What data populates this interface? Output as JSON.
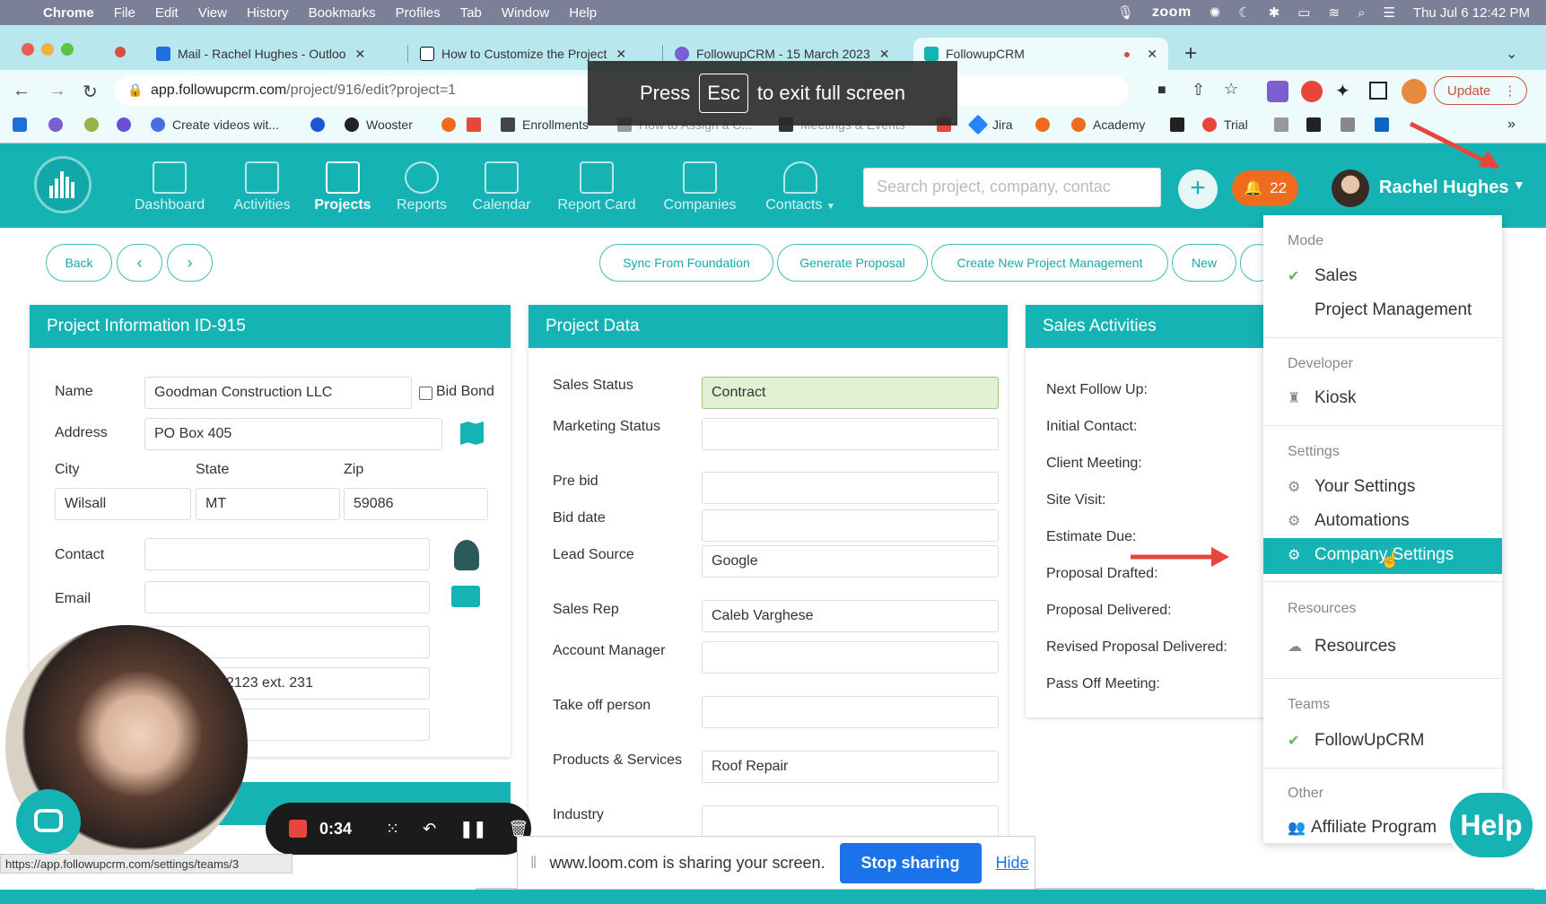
{
  "mac": {
    "menus": [
      "Chrome",
      "File",
      "Edit",
      "View",
      "History",
      "Bookmarks",
      "Profiles",
      "Tab",
      "Window",
      "Help"
    ],
    "zoom": "zoom",
    "clock": "Thu Jul 6  12:42 PM"
  },
  "browser": {
    "tabs": [
      {
        "title": "Mail - Rachel Hughes - Outloo",
        "color": "#1e6fd9"
      },
      {
        "title": "How to Customize the Project",
        "color": "#111111"
      },
      {
        "title": "FollowupCRM - 15 March 2023",
        "color": "#7b5fd1"
      },
      {
        "title": "FollowupCRM",
        "color": "#16b3b4"
      }
    ],
    "url_host": "app.followupcrm.com",
    "url_path": "/project/916/edit?project=1",
    "update_label": "Update",
    "bookmarks": [
      "Create videos wit...",
      "Wooster",
      "Enrollments",
      "How to Assign a C...",
      "Meetings & Events",
      "Jira",
      "Academy",
      "Trial"
    ],
    "fullscreen": {
      "press": "Press",
      "key": "Esc",
      "rest": "to exit full screen"
    }
  },
  "app": {
    "nav": [
      "Dashboard",
      "Activities",
      "Projects",
      "Reports",
      "Calendar",
      "Report Card",
      "Companies",
      "Contacts"
    ],
    "search_placeholder": "Search project, company, contac",
    "notif_count": "22",
    "user_name": "Rachel Hughes",
    "brand_color": "#16b3b4"
  },
  "actions": {
    "back": "Back",
    "sync": "Sync From Foundation",
    "generate": "Generate Proposal",
    "create_pm": "Create New Project Management",
    "new": "New"
  },
  "project_info": {
    "title": "Project Information ID-915",
    "name_label": "Name",
    "name_value": "Goodman Construction LLC",
    "bid_bond": "Bid Bond",
    "address_label": "Address",
    "address_value": "PO Box 405",
    "city_label": "City",
    "city_value": "Wilsall",
    "state_label": "State",
    "state_value": "MT",
    "zip_label": "Zip",
    "zip_value": "59086",
    "contact_label": "Contact",
    "email_label": "Email",
    "phone_fragment": "2123 ext. 231"
  },
  "project_data": {
    "title": "Project Data",
    "rows": [
      {
        "label": "Sales Status",
        "value": "Contract"
      },
      {
        "label": "Marketing Status",
        "value": ""
      },
      {
        "label": "Pre bid",
        "value": ""
      },
      {
        "label": "Bid date",
        "value": ""
      },
      {
        "label": "Lead Source",
        "value": "Google"
      },
      {
        "label": "Sales Rep",
        "value": "Caleb Varghese"
      },
      {
        "label": "Account Manager",
        "value": ""
      },
      {
        "label": "Take off person",
        "value": ""
      },
      {
        "label": "Products & Services",
        "value": "Roof Repair"
      },
      {
        "label": "Industry",
        "value": ""
      }
    ]
  },
  "sales_activities": {
    "title": "Sales Activities",
    "rows": [
      "Next Follow Up:",
      "Initial Contact:",
      "Client Meeting:",
      "Site Visit:",
      "Estimate Due:",
      "Proposal Drafted:",
      "Proposal Delivered:",
      "Revised Proposal Delivered:",
      "Pass Off Meeting:"
    ]
  },
  "user_menu": {
    "mode_header": "Mode",
    "sales": "Sales",
    "project_management": "Project Management",
    "developer_header": "Developer",
    "kiosk": "Kiosk",
    "settings_header": "Settings",
    "your_settings": "Your Settings",
    "automations": "Automations",
    "company_settings": "Company Settings",
    "resources_header": "Resources",
    "resources": "Resources",
    "teams_header": "Teams",
    "followupcrm": "FollowUpCRM",
    "other_header": "Other",
    "affiliate": "Affiliate Program"
  },
  "loom": {
    "timer": "0:34",
    "status_url": "https://app.followupcrm.com/settings/teams/3",
    "share_text": "www.loom.com is sharing your screen.",
    "stop_sharing": "Stop sharing",
    "hide": "Hide",
    "help": "Help"
  }
}
